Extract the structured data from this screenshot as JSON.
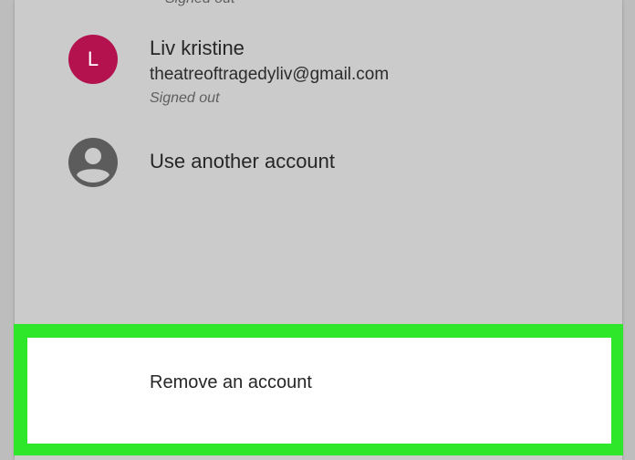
{
  "previous_account": {
    "status": "Signed out"
  },
  "account": {
    "avatar_letter": "L",
    "avatar_color": "#b3124e",
    "name": "Liv kristine",
    "email": "theatreoftragedyliv@gmail.com",
    "status": "Signed out"
  },
  "other_account": {
    "icon": "account-circle-icon",
    "label": "Use another account"
  },
  "remove_account": {
    "label": "Remove an account",
    "highlight_color": "#2ee62a"
  }
}
